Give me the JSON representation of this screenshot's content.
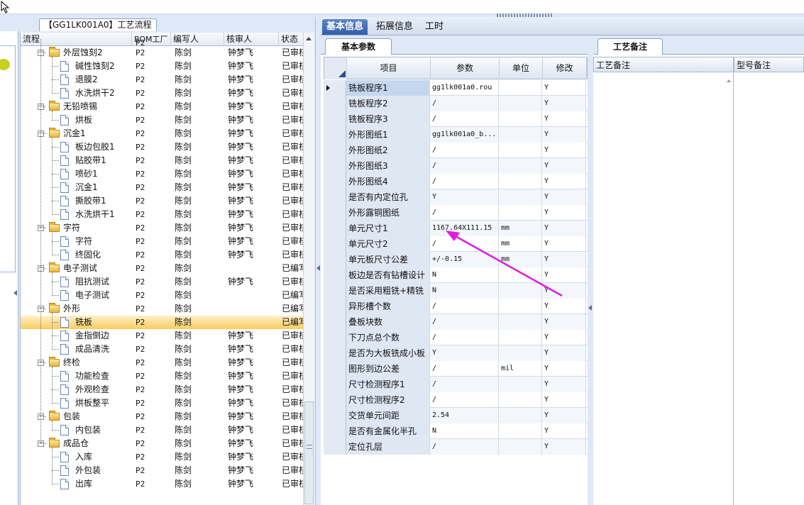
{
  "window": {
    "left_tab_title": "【GG1LK001A0】工艺流程"
  },
  "tree": {
    "columns": [
      "流程",
      "BOM工厂",
      "编写人",
      "核审人",
      "状态"
    ],
    "rows": [
      {
        "depth": 1,
        "type": "folder",
        "label": "外层蚀刻2",
        "bom": "P2",
        "writer": "陈剑",
        "reviewer": "钟梦飞",
        "state": "已审核"
      },
      {
        "depth": 2,
        "type": "doc",
        "label": "碱性蚀刻2",
        "bom": "P2",
        "writer": "陈剑",
        "reviewer": "钟梦飞",
        "state": "已审核"
      },
      {
        "depth": 2,
        "type": "doc",
        "label": "退膜2",
        "bom": "P2",
        "writer": "陈剑",
        "reviewer": "钟梦飞",
        "state": "已审核"
      },
      {
        "depth": 2,
        "type": "doc",
        "label": "水洗烘干2",
        "bom": "P2",
        "writer": "陈剑",
        "reviewer": "钟梦飞",
        "state": "已审核"
      },
      {
        "depth": 1,
        "type": "folder",
        "label": "无铅喷锡",
        "bom": "P2",
        "writer": "陈剑",
        "reviewer": "钟梦飞",
        "state": "已审核"
      },
      {
        "depth": 2,
        "type": "doc",
        "label": "烘板",
        "bom": "P2",
        "writer": "陈剑",
        "reviewer": "钟梦飞",
        "state": "已审核"
      },
      {
        "depth": 1,
        "type": "folder",
        "label": "沉金1",
        "bom": "P2",
        "writer": "陈剑",
        "reviewer": "钟梦飞",
        "state": "已审核"
      },
      {
        "depth": 2,
        "type": "doc",
        "label": "板边包胶1",
        "bom": "P2",
        "writer": "陈剑",
        "reviewer": "钟梦飞",
        "state": "已审核"
      },
      {
        "depth": 2,
        "type": "doc",
        "label": "贴胶带1",
        "bom": "P2",
        "writer": "陈剑",
        "reviewer": "钟梦飞",
        "state": "已审核"
      },
      {
        "depth": 2,
        "type": "doc",
        "label": "喷砂1",
        "bom": "P2",
        "writer": "陈剑",
        "reviewer": "钟梦飞",
        "state": "已审核"
      },
      {
        "depth": 2,
        "type": "doc",
        "label": "沉金1",
        "bom": "P2",
        "writer": "陈剑",
        "reviewer": "钟梦飞",
        "state": "已审核"
      },
      {
        "depth": 2,
        "type": "doc",
        "label": "撕胶带1",
        "bom": "P2",
        "writer": "陈剑",
        "reviewer": "钟梦飞",
        "state": "已审核"
      },
      {
        "depth": 2,
        "type": "doc",
        "label": "水洗烘干1",
        "bom": "P2",
        "writer": "陈剑",
        "reviewer": "钟梦飞",
        "state": "已审核"
      },
      {
        "depth": 1,
        "type": "folder",
        "label": "字符",
        "bom": "P2",
        "writer": "陈剑",
        "reviewer": "钟梦飞",
        "state": "已审核"
      },
      {
        "depth": 2,
        "type": "doc",
        "label": "字符",
        "bom": "P2",
        "writer": "陈剑",
        "reviewer": "钟梦飞",
        "state": "已审核"
      },
      {
        "depth": 2,
        "type": "doc",
        "label": "终固化",
        "bom": "P2",
        "writer": "陈剑",
        "reviewer": "钟梦飞",
        "state": "已审核"
      },
      {
        "depth": 1,
        "type": "folder",
        "label": "电子测试",
        "bom": "P2",
        "writer": "陈剑",
        "reviewer": "",
        "state": "已编写"
      },
      {
        "depth": 2,
        "type": "doc",
        "label": "阻抗测试",
        "bom": "P2",
        "writer": "陈剑",
        "reviewer": "钟梦飞",
        "state": "已审核"
      },
      {
        "depth": 2,
        "type": "doc",
        "label": "电子测试",
        "bom": "P2",
        "writer": "陈剑",
        "reviewer": "",
        "state": "已编写"
      },
      {
        "depth": 1,
        "type": "folder",
        "label": "外形",
        "bom": "P2",
        "writer": "陈剑",
        "reviewer": "",
        "state": "已编写"
      },
      {
        "depth": 2,
        "type": "doc",
        "label": "铣板",
        "bom": "P2",
        "writer": "陈剑",
        "reviewer": "",
        "state": "已编写",
        "selected": true
      },
      {
        "depth": 2,
        "type": "doc",
        "label": "金指倒边",
        "bom": "P2",
        "writer": "陈剑",
        "reviewer": "钟梦飞",
        "state": "已审核"
      },
      {
        "depth": 2,
        "type": "doc",
        "label": "成品清洗",
        "bom": "P2",
        "writer": "陈剑",
        "reviewer": "钟梦飞",
        "state": "已审核"
      },
      {
        "depth": 1,
        "type": "folder",
        "label": "终检",
        "bom": "P2",
        "writer": "陈剑",
        "reviewer": "钟梦飞",
        "state": "已审核"
      },
      {
        "depth": 2,
        "type": "doc",
        "label": "功能检查",
        "bom": "P2",
        "writer": "陈剑",
        "reviewer": "钟梦飞",
        "state": "已审核"
      },
      {
        "depth": 2,
        "type": "doc",
        "label": "外观检查",
        "bom": "P2",
        "writer": "陈剑",
        "reviewer": "钟梦飞",
        "state": "已审核"
      },
      {
        "depth": 2,
        "type": "doc",
        "label": "烘板整平",
        "bom": "P2",
        "writer": "陈剑",
        "reviewer": "钟梦飞",
        "state": "已审核"
      },
      {
        "depth": 1,
        "type": "folder",
        "label": "包装",
        "bom": "P2",
        "writer": "陈剑",
        "reviewer": "钟梦飞",
        "state": "已审核"
      },
      {
        "depth": 2,
        "type": "doc",
        "label": "内包装",
        "bom": "P2",
        "writer": "陈剑",
        "reviewer": "钟梦飞",
        "state": "已审核"
      },
      {
        "depth": 1,
        "type": "folder",
        "label": "成品仓",
        "bom": "P2",
        "writer": "陈剑",
        "reviewer": "钟梦飞",
        "state": "已审核"
      },
      {
        "depth": 2,
        "type": "doc",
        "label": "入库",
        "bom": "P2",
        "writer": "陈剑",
        "reviewer": "钟梦飞",
        "state": "已审核"
      },
      {
        "depth": 2,
        "type": "doc",
        "label": "外包装",
        "bom": "P2",
        "writer": "陈剑",
        "reviewer": "钟梦飞",
        "state": "已审核"
      },
      {
        "depth": 2,
        "type": "doc",
        "label": "出库",
        "bom": "P2",
        "writer": "陈剑",
        "reviewer": "钟梦飞",
        "state": "已审核"
      }
    ]
  },
  "main_tabs": {
    "basic": "基本信息",
    "extended": "拓展信息",
    "hours": "工时"
  },
  "params": {
    "subtab": "基本参数",
    "columns": {
      "item": "项目",
      "param": "参数",
      "unit": "单位",
      "modify": "修改"
    },
    "rows": [
      {
        "item": "铣板程序1",
        "param": "gg1lk001a0.rou",
        "unit": "",
        "modify": "Y"
      },
      {
        "item": "铣板程序2",
        "param": "/",
        "unit": "",
        "modify": "Y"
      },
      {
        "item": "铣板程序3",
        "param": "/",
        "unit": "",
        "modify": "Y"
      },
      {
        "item": "外形图纸1",
        "param": "gg1lk001a0_b...",
        "unit": "",
        "modify": "Y"
      },
      {
        "item": "外形图纸2",
        "param": "/",
        "unit": "",
        "modify": "Y"
      },
      {
        "item": "外形图纸3",
        "param": "/",
        "unit": "",
        "modify": "Y"
      },
      {
        "item": "外形图纸4",
        "param": "/",
        "unit": "",
        "modify": "Y"
      },
      {
        "item": "是否有内定位孔",
        "param": "Y",
        "unit": "",
        "modify": "Y"
      },
      {
        "item": "外形露铜图纸",
        "param": "/",
        "unit": "",
        "modify": "Y"
      },
      {
        "item": "单元尺寸1",
        "param": "1167.64X111.15",
        "unit": "mm",
        "modify": "Y"
      },
      {
        "item": "单元尺寸2",
        "param": "/",
        "unit": "mm",
        "modify": "Y"
      },
      {
        "item": "单元板尺寸公差",
        "param": "+/-0.15",
        "unit": "mm",
        "modify": "Y"
      },
      {
        "item": "板边是否有钻槽设计",
        "param": "N",
        "unit": "",
        "modify": "Y"
      },
      {
        "item": "是否采用粗铣+精铣",
        "param": "N",
        "unit": "",
        "modify": "Y"
      },
      {
        "item": "异形槽个数",
        "param": "/",
        "unit": "",
        "modify": "Y"
      },
      {
        "item": "叠板块数",
        "param": "/",
        "unit": "",
        "modify": "Y"
      },
      {
        "item": "下刀点总个数",
        "param": "/",
        "unit": "",
        "modify": "Y"
      },
      {
        "item": "是否为大板铣成小板",
        "param": "Y",
        "unit": "",
        "modify": "Y"
      },
      {
        "item": "图形到边公差",
        "param": "/",
        "unit": "mil",
        "modify": "Y"
      },
      {
        "item": "尺寸检测程序1",
        "param": "/",
        "unit": "",
        "modify": "Y"
      },
      {
        "item": "尺寸检测程序2",
        "param": "/",
        "unit": "",
        "modify": "Y"
      },
      {
        "item": "交货单元间距",
        "param": "2.54",
        "unit": "",
        "modify": "Y"
      },
      {
        "item": "是否有金属化半孔",
        "param": "N",
        "unit": "",
        "modify": "Y"
      },
      {
        "item": "定位孔层",
        "param": "/",
        "unit": "",
        "modify": "Y"
      }
    ]
  },
  "right": {
    "tab": "工艺备注",
    "col1": "工艺备注",
    "col2": "型号备注"
  },
  "colors": {
    "annotation_arrow": "#e01be0",
    "selection": "#f8cd5f",
    "active_tab": "#2f5ea8"
  }
}
